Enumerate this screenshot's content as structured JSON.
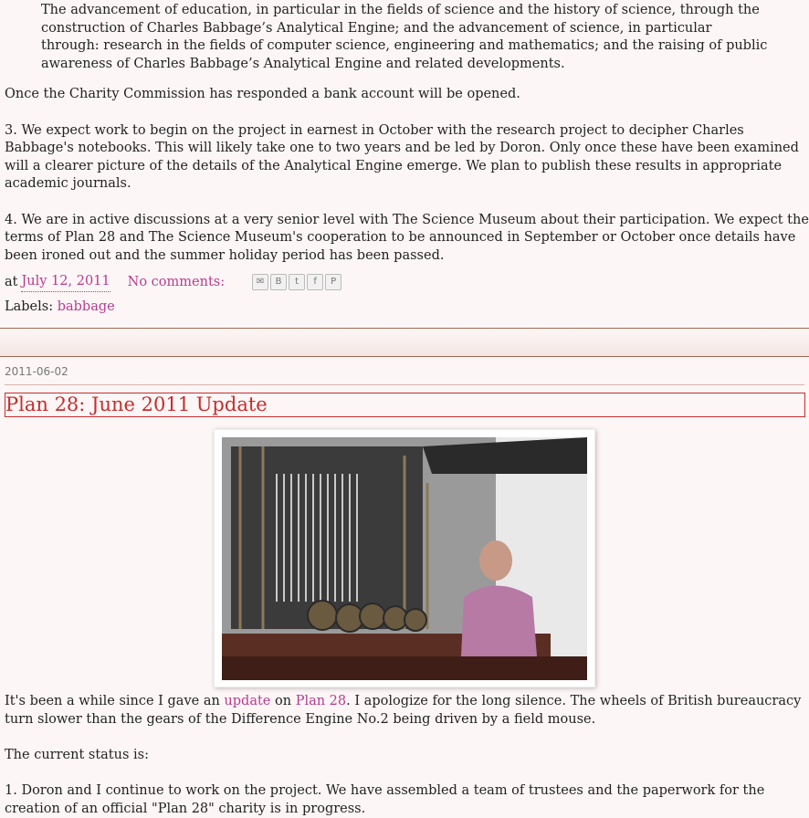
{
  "post1": {
    "quote": "The advancement of education, in particular in the fields of science and the history of science, through the construction of Charles Babbage’s Analytical Engine; and the advancement of science, in particular through: research in the fields of computer science, engineering and mathematics; and the raising of public awareness of Charles Babbage’s Analytical Engine and related developments.",
    "p1": "Once the Charity Commission has responded a bank account will be opened.",
    "p2": "3. We expect work to begin on the project in earnest in October with the research project to decipher Charles Babbage's notebooks. This will likely take one to two years and be led by Doron. Only once these have been examined will a clearer picture of the details of the Analytical Engine emerge. We plan to publish these results in appropriate academic journals.",
    "p3": "4. We are in active discussions at a very senior level with The Science Museum about their participation. We expect the terms of Plan 28 and The Science Museum's cooperation to be announced in September or October once details have been ironed out and the summer holiday period has been passed.",
    "footer": {
      "at": "at",
      "date": "July 12, 2011",
      "comments": "No comments:",
      "share_icons": [
        "email-icon",
        "blogger-icon",
        "twitter-icon",
        "facebook-icon",
        "pinterest-icon"
      ]
    },
    "labels_prefix": "Labels:",
    "label": "babbage"
  },
  "post2": {
    "date_header": "2011-06-02",
    "title": "Plan 28: June 2011 Update",
    "intro_before": "It's been a while since I gave an ",
    "link_update": "update",
    "intro_on": " on ",
    "link_plan": "Plan 28",
    "intro_after": ". I apologize for the long silence. The wheels of British bureaucracy turn slower than the gears of the Difference Engine No.2 being driven by a field mouse.",
    "status": "The current status is:",
    "item1": "1. Doron and I continue to work on the project. We have assembled a team of trustees and the paperwork for the creation of an official \"Plan 28\" charity is in progress."
  },
  "colors": {
    "link": "#b83a8f",
    "title": "#c62d2d",
    "background": "#fdf6f6"
  }
}
